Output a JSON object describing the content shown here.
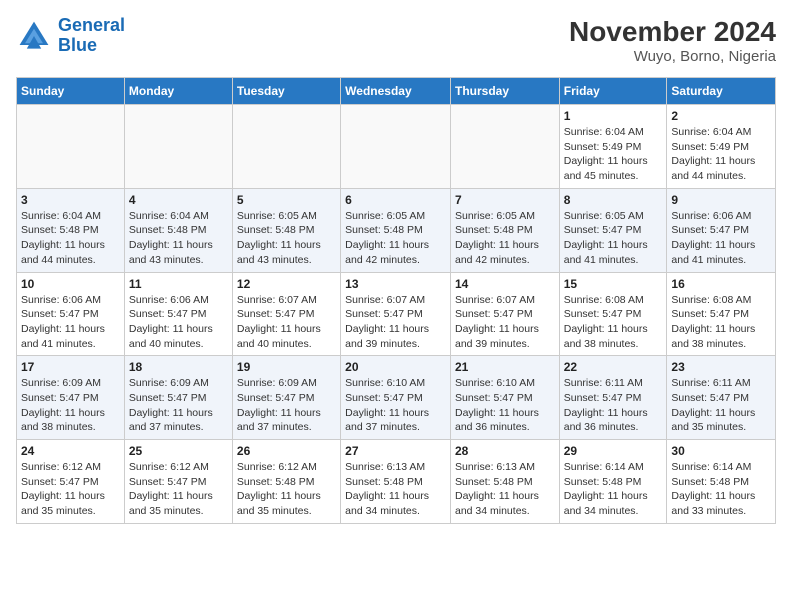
{
  "header": {
    "logo_line1": "General",
    "logo_line2": "Blue",
    "title": "November 2024",
    "subtitle": "Wuyo, Borno, Nigeria"
  },
  "days_of_week": [
    "Sunday",
    "Monday",
    "Tuesday",
    "Wednesday",
    "Thursday",
    "Friday",
    "Saturday"
  ],
  "weeks": [
    [
      {
        "day": "",
        "info": ""
      },
      {
        "day": "",
        "info": ""
      },
      {
        "day": "",
        "info": ""
      },
      {
        "day": "",
        "info": ""
      },
      {
        "day": "",
        "info": ""
      },
      {
        "day": "1",
        "info": "Sunrise: 6:04 AM\nSunset: 5:49 PM\nDaylight: 11 hours\nand 45 minutes."
      },
      {
        "day": "2",
        "info": "Sunrise: 6:04 AM\nSunset: 5:49 PM\nDaylight: 11 hours\nand 44 minutes."
      }
    ],
    [
      {
        "day": "3",
        "info": "Sunrise: 6:04 AM\nSunset: 5:48 PM\nDaylight: 11 hours\nand 44 minutes."
      },
      {
        "day": "4",
        "info": "Sunrise: 6:04 AM\nSunset: 5:48 PM\nDaylight: 11 hours\nand 43 minutes."
      },
      {
        "day": "5",
        "info": "Sunrise: 6:05 AM\nSunset: 5:48 PM\nDaylight: 11 hours\nand 43 minutes."
      },
      {
        "day": "6",
        "info": "Sunrise: 6:05 AM\nSunset: 5:48 PM\nDaylight: 11 hours\nand 42 minutes."
      },
      {
        "day": "7",
        "info": "Sunrise: 6:05 AM\nSunset: 5:48 PM\nDaylight: 11 hours\nand 42 minutes."
      },
      {
        "day": "8",
        "info": "Sunrise: 6:05 AM\nSunset: 5:47 PM\nDaylight: 11 hours\nand 41 minutes."
      },
      {
        "day": "9",
        "info": "Sunrise: 6:06 AM\nSunset: 5:47 PM\nDaylight: 11 hours\nand 41 minutes."
      }
    ],
    [
      {
        "day": "10",
        "info": "Sunrise: 6:06 AM\nSunset: 5:47 PM\nDaylight: 11 hours\nand 41 minutes."
      },
      {
        "day": "11",
        "info": "Sunrise: 6:06 AM\nSunset: 5:47 PM\nDaylight: 11 hours\nand 40 minutes."
      },
      {
        "day": "12",
        "info": "Sunrise: 6:07 AM\nSunset: 5:47 PM\nDaylight: 11 hours\nand 40 minutes."
      },
      {
        "day": "13",
        "info": "Sunrise: 6:07 AM\nSunset: 5:47 PM\nDaylight: 11 hours\nand 39 minutes."
      },
      {
        "day": "14",
        "info": "Sunrise: 6:07 AM\nSunset: 5:47 PM\nDaylight: 11 hours\nand 39 minutes."
      },
      {
        "day": "15",
        "info": "Sunrise: 6:08 AM\nSunset: 5:47 PM\nDaylight: 11 hours\nand 38 minutes."
      },
      {
        "day": "16",
        "info": "Sunrise: 6:08 AM\nSunset: 5:47 PM\nDaylight: 11 hours\nand 38 minutes."
      }
    ],
    [
      {
        "day": "17",
        "info": "Sunrise: 6:09 AM\nSunset: 5:47 PM\nDaylight: 11 hours\nand 38 minutes."
      },
      {
        "day": "18",
        "info": "Sunrise: 6:09 AM\nSunset: 5:47 PM\nDaylight: 11 hours\nand 37 minutes."
      },
      {
        "day": "19",
        "info": "Sunrise: 6:09 AM\nSunset: 5:47 PM\nDaylight: 11 hours\nand 37 minutes."
      },
      {
        "day": "20",
        "info": "Sunrise: 6:10 AM\nSunset: 5:47 PM\nDaylight: 11 hours\nand 37 minutes."
      },
      {
        "day": "21",
        "info": "Sunrise: 6:10 AM\nSunset: 5:47 PM\nDaylight: 11 hours\nand 36 minutes."
      },
      {
        "day": "22",
        "info": "Sunrise: 6:11 AM\nSunset: 5:47 PM\nDaylight: 11 hours\nand 36 minutes."
      },
      {
        "day": "23",
        "info": "Sunrise: 6:11 AM\nSunset: 5:47 PM\nDaylight: 11 hours\nand 35 minutes."
      }
    ],
    [
      {
        "day": "24",
        "info": "Sunrise: 6:12 AM\nSunset: 5:47 PM\nDaylight: 11 hours\nand 35 minutes."
      },
      {
        "day": "25",
        "info": "Sunrise: 6:12 AM\nSunset: 5:47 PM\nDaylight: 11 hours\nand 35 minutes."
      },
      {
        "day": "26",
        "info": "Sunrise: 6:12 AM\nSunset: 5:48 PM\nDaylight: 11 hours\nand 35 minutes."
      },
      {
        "day": "27",
        "info": "Sunrise: 6:13 AM\nSunset: 5:48 PM\nDaylight: 11 hours\nand 34 minutes."
      },
      {
        "day": "28",
        "info": "Sunrise: 6:13 AM\nSunset: 5:48 PM\nDaylight: 11 hours\nand 34 minutes."
      },
      {
        "day": "29",
        "info": "Sunrise: 6:14 AM\nSunset: 5:48 PM\nDaylight: 11 hours\nand 34 minutes."
      },
      {
        "day": "30",
        "info": "Sunrise: 6:14 AM\nSunset: 5:48 PM\nDaylight: 11 hours\nand 33 minutes."
      }
    ]
  ]
}
